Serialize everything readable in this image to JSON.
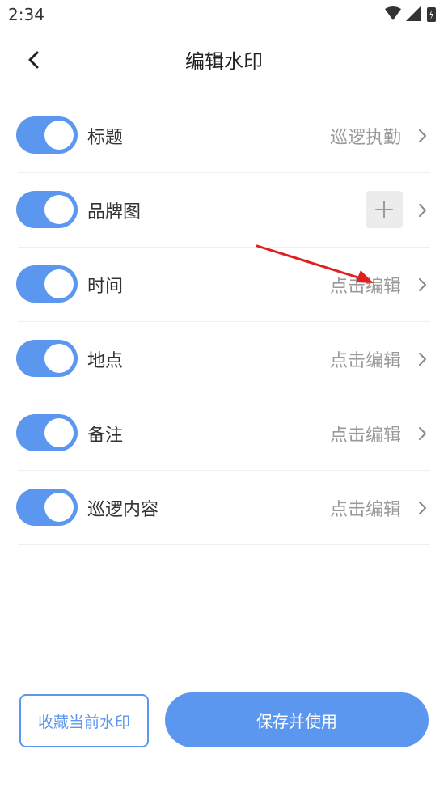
{
  "status_bar": {
    "time": "2:34",
    "icons": [
      "wifi-icon",
      "signal-icon",
      "battery-charging-icon"
    ]
  },
  "header": {
    "title": "编辑水印",
    "back_icon": "chevron-left-icon"
  },
  "rows": [
    {
      "label": "标题",
      "value": "巡逻执勤",
      "enabled": true
    },
    {
      "label": "品牌图",
      "value": "",
      "enabled": true,
      "action_icon": "plus-icon"
    },
    {
      "label": "时间",
      "value": "点击编辑",
      "enabled": true
    },
    {
      "label": "地点",
      "value": "点击编辑",
      "enabled": true
    },
    {
      "label": "备注",
      "value": "点击编辑",
      "enabled": true
    },
    {
      "label": "巡逻内容",
      "value": "点击编辑",
      "enabled": true
    }
  ],
  "footer": {
    "favorite_label": "收藏当前水印",
    "save_label": "保存并使用"
  },
  "colors": {
    "accent": "#5b96ef",
    "annotation_arrow": "#e02020"
  }
}
